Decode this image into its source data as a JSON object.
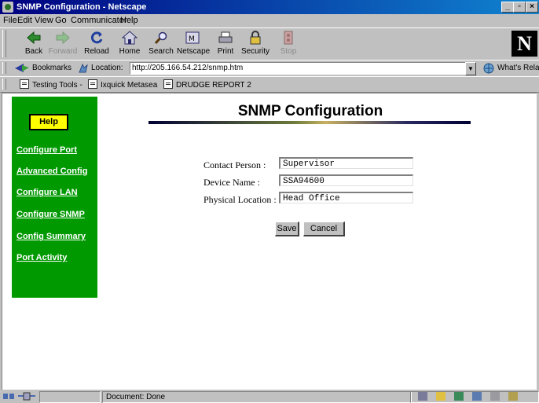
{
  "window": {
    "title": "SNMP Configuration - Netscape"
  },
  "menu": [
    "File",
    "Edit",
    "View",
    "Go",
    "Communicator",
    "Help"
  ],
  "toolbar": {
    "buttons": [
      {
        "label": "Back",
        "enabled": true
      },
      {
        "label": "Forward",
        "enabled": false
      },
      {
        "label": "Reload",
        "enabled": true
      },
      {
        "label": "Home",
        "enabled": true
      },
      {
        "label": "Search",
        "enabled": true
      },
      {
        "label": "Netscape",
        "enabled": true
      },
      {
        "label": "Print",
        "enabled": true
      },
      {
        "label": "Security",
        "enabled": true
      },
      {
        "label": "Stop",
        "enabled": false
      }
    ],
    "logo": "N"
  },
  "location_bar": {
    "bookmarks_label": "Bookmarks",
    "location_label": "Location:",
    "url": "http://205.166.54.212/snmp.htm",
    "whats_related": "What's Related"
  },
  "personal_toolbar": [
    "Testing Tools -",
    "Ixquick Metasea",
    "DRUDGE REPORT 2"
  ],
  "sidebar": {
    "help_label": "Help",
    "links": [
      "Configure Port",
      "Advanced Config",
      "Configure LAN",
      "Configure SNMP",
      "Config Summary",
      "Port Activity"
    ]
  },
  "page": {
    "title": "SNMP Configuration",
    "fields": [
      {
        "label": "Contact Person :",
        "value": "Supervisor"
      },
      {
        "label": "Device Name :",
        "value": "SSA94600"
      },
      {
        "label": "Physical Location :",
        "value": "Head Office"
      }
    ],
    "save_label": "Save",
    "cancel_label": "Cancel"
  },
  "status": {
    "text": "Document: Done"
  },
  "colors": {
    "sidebar": "#009900",
    "help_button": "#ffff00",
    "titlebar": "#000080"
  }
}
